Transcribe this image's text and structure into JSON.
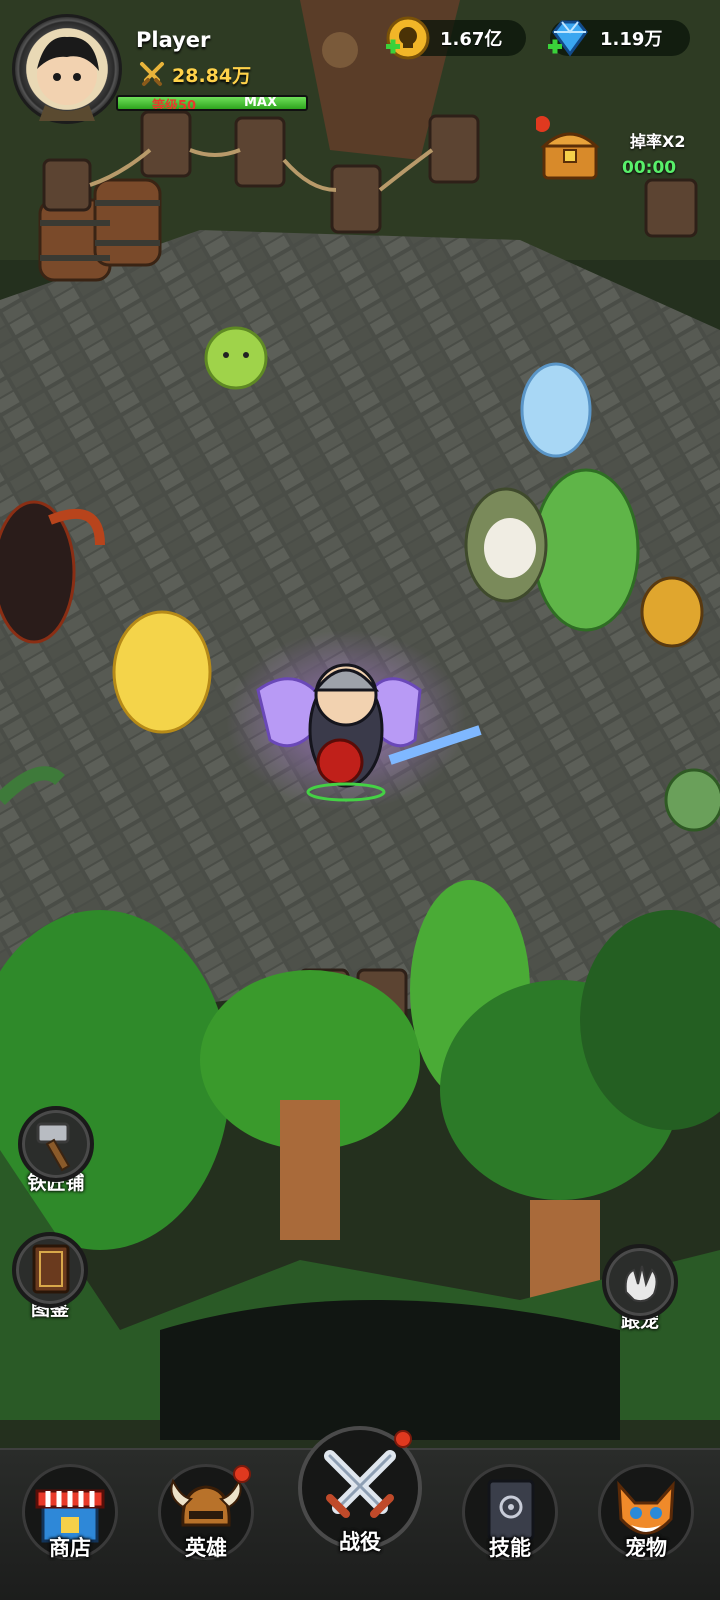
{
  "player": {
    "name": "Player",
    "power": "28.84万",
    "level_label": "等级50",
    "level_max": "MAX",
    "xp_fraction": 1.0
  },
  "currencies": {
    "gold": "1.67亿",
    "gems": "1.19万"
  },
  "drop_bonus": {
    "label": "掉率X2",
    "timer": "00:00"
  },
  "side_buttons": {
    "blacksmith": "铁匠铺",
    "codex": "图鉴",
    "follow_pet": "跟宠"
  },
  "nav": {
    "shop": "商店",
    "heroes": "英雄",
    "campaign": "战役",
    "skills": "技能",
    "pets": "宠物"
  },
  "colors": {
    "gold_text": "#ffd24a",
    "timer_green": "#58f06a",
    "level_red": "#e63a2b",
    "xp_green": "#3fbf2a",
    "badge_red": "#e0391f"
  }
}
